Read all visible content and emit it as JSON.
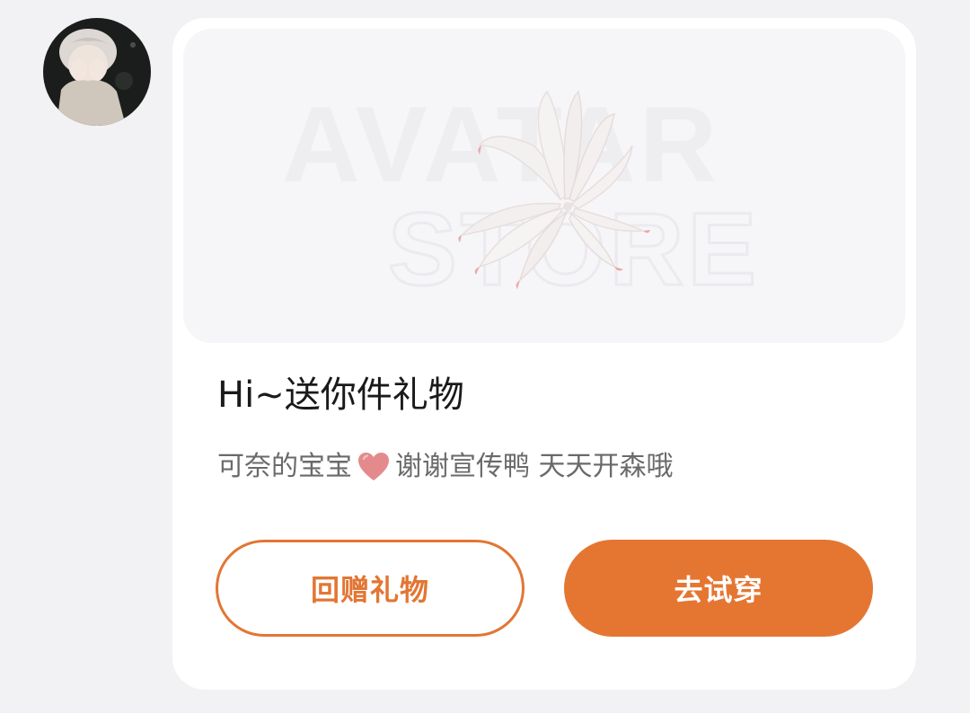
{
  "avatar": {
    "icon": "user-avatar-photo"
  },
  "card": {
    "banner": {
      "watermark_line1": "AVATAR",
      "watermark_line2": "STORE",
      "icon": "nine-tail-fox-tail-ornament"
    },
    "title": "Hi~送你件礼物",
    "message": {
      "before_heart": "可奈的宝宝",
      "heart_icon": "heart-emoji",
      "after_heart": "谢谢宣传鸭 天天开森哦"
    },
    "buttons": {
      "return_gift": "回赠礼物",
      "try_on": "去试穿"
    }
  },
  "colors": {
    "accent": "#e57632",
    "page_background": "#f2f2f4",
    "card_background": "#ffffff"
  }
}
